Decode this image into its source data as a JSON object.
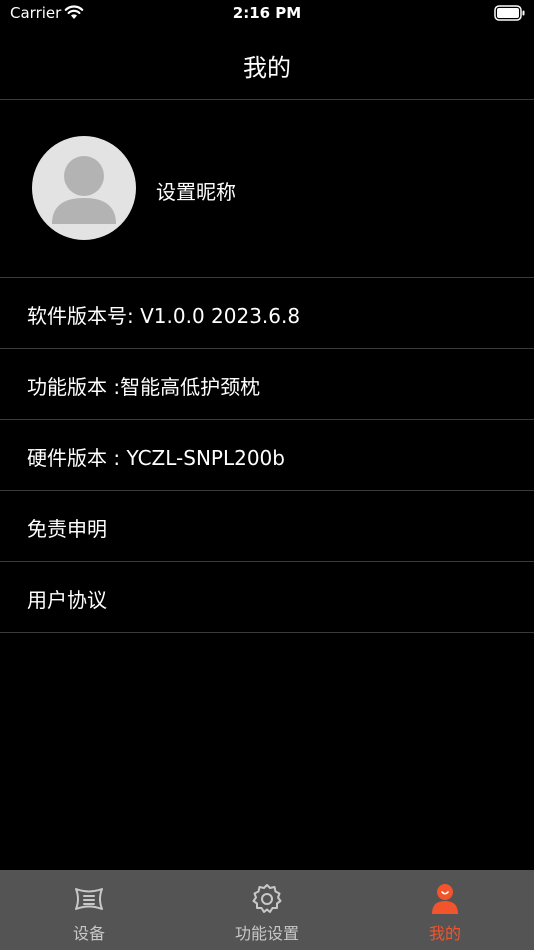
{
  "status_bar": {
    "carrier": "Carrier",
    "time": "2:16 PM"
  },
  "nav": {
    "title": "我的"
  },
  "profile": {
    "nickname": "设置昵称"
  },
  "info_rows": [
    {
      "label": "软件版本号: V1.0.0 2023.6.8"
    },
    {
      "label": "功能版本 :智能高低护颈枕"
    },
    {
      "label": "硬件版本 : YCZL-SNPL200b"
    },
    {
      "label": "免责申明"
    },
    {
      "label": "用户协议"
    }
  ],
  "tab_bar": {
    "tabs": [
      {
        "label": "设备",
        "icon": "pillow-icon",
        "active": false
      },
      {
        "label": "功能设置",
        "icon": "gear-icon",
        "active": false
      },
      {
        "label": "我的",
        "icon": "user-icon",
        "active": true
      }
    ]
  },
  "colors": {
    "background": "#000000",
    "tab_bar_background": "#545454",
    "accent": "#f2552c",
    "divider": "#3a3a3a",
    "avatar_background": "#e3e3e3"
  }
}
